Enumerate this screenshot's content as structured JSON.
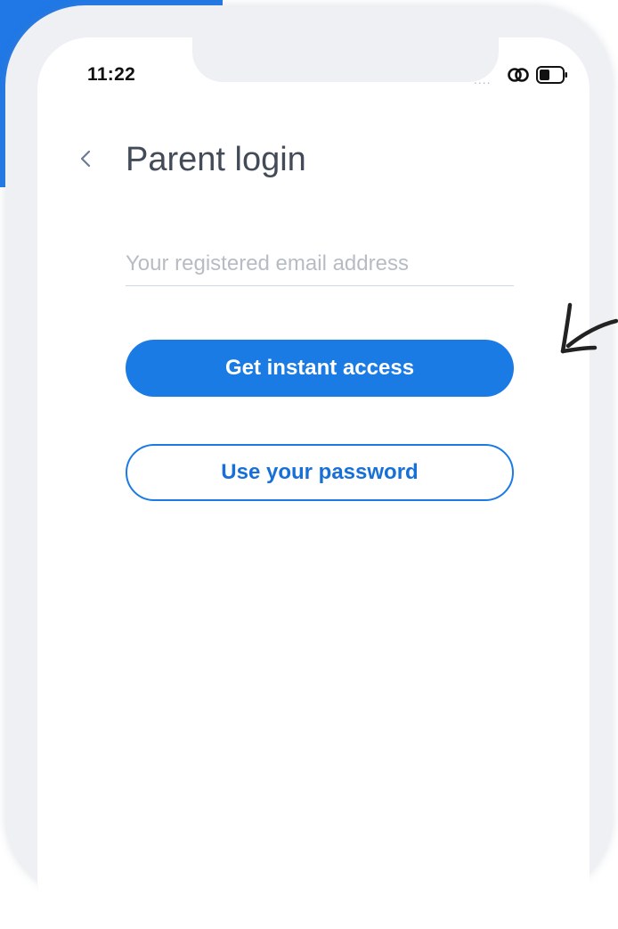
{
  "status_bar": {
    "time": "11:22",
    "signal_dots": "....",
    "icons": [
      "link-icon",
      "battery-icon"
    ]
  },
  "header": {
    "back_icon": "chevron-left-icon",
    "title": "Parent login"
  },
  "form": {
    "email_placeholder": "Your registered email address",
    "email_value": ""
  },
  "actions": {
    "primary_label": "Get instant access",
    "secondary_label": "Use your password"
  },
  "colors": {
    "accent": "#1a7be5",
    "background_blue": "#1f78e6",
    "title_text": "#434a58",
    "placeholder": "#b7bcc4"
  },
  "annotation": {
    "arrow_icon": "hand-drawn-arrow-icon"
  }
}
